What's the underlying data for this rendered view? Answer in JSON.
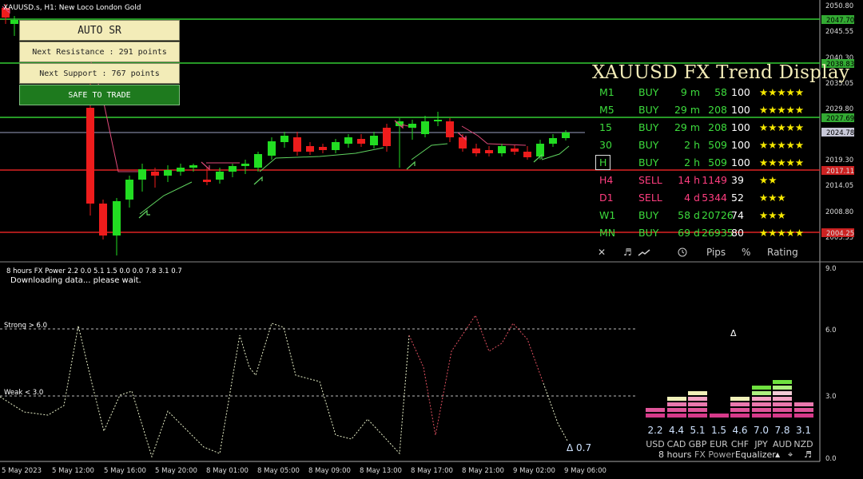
{
  "chart_header": "XAUUSD.s, H1:  New Loco London Gold",
  "price_axis": [
    "2050.80",
    "2045.55",
    "2040.30",
    "2035.05",
    "2029.80",
    "2024.78",
    "2019.30",
    "2014.05",
    "2008.80",
    "2003.55"
  ],
  "tags": {
    "r1": "2047.70",
    "r2": "2038.83",
    "r3": "2027.69",
    "cur": "2024.78",
    "s1": "2017.11",
    "s2": "2004.25"
  },
  "auto_sr": {
    "title": "AUTO  SR",
    "resistance": "Next Resistance : 291 points",
    "support": "Next Support : 767 points",
    "status": "SAFE TO TRADE"
  },
  "trend": {
    "title": "XAUUSD FX Trend Display",
    "rows": [
      {
        "tf": "M1",
        "signal": "BUY",
        "time": "9 m",
        "pips": "58",
        "pct": "100",
        "stars": "★★★★★"
      },
      {
        "tf": "M5",
        "signal": "BUY",
        "time": "29 m",
        "pips": "208",
        "pct": "100",
        "stars": "★★★★★"
      },
      {
        "tf": "15",
        "signal": "BUY",
        "time": "29 m",
        "pips": "208",
        "pct": "100",
        "stars": "★★★★★"
      },
      {
        "tf": "30",
        "signal": "BUY",
        "time": "2 h",
        "pips": "509",
        "pct": "100",
        "stars": "★★★★★"
      },
      {
        "tf": "H",
        "signal": "BUY",
        "time": "2 h",
        "pips": "509",
        "pct": "100",
        "stars": "★★★★★"
      },
      {
        "tf": "H4",
        "signal": "SELL",
        "time": "14 h",
        "pips": "1149",
        "pct": "39",
        "stars": "★★"
      },
      {
        "tf": "D1",
        "signal": "SELL",
        "time": "4 d",
        "pips": "5344",
        "pct": "52",
        "stars": "★★★"
      },
      {
        "tf": "W1",
        "signal": "BUY",
        "time": "58 d",
        "pips": "20726",
        "pct": "74",
        "stars": "★★★"
      },
      {
        "tf": "MN",
        "signal": "BUY",
        "time": "69 d",
        "pips": "26935",
        "pct": "80",
        "stars": "★★★★★"
      }
    ],
    "footer": {
      "close": "✕",
      "sound": "♬",
      "pips": "Pips",
      "percent": "%",
      "rating": "Rating"
    }
  },
  "indicator": {
    "header": "8 hours FX Power 2.2 0.0 5.1 1.5 0.0 0.0 7.8 3.1 0.7",
    "status": "Downloading data... please wait.",
    "strong_label": "Strong > 6.0",
    "weak_label": "Weak < 3.0",
    "delta_top": "Δ",
    "delta_value": "Δ 0.7",
    "axis": [
      "9.0",
      "6.0",
      "3.0",
      "0.0"
    ]
  },
  "equalizer": {
    "currencies": [
      {
        "name": "USD",
        "value": "2.2"
      },
      {
        "name": "CAD",
        "value": "4.4"
      },
      {
        "name": "GBP",
        "value": "5.1"
      },
      {
        "name": "EUR",
        "value": "1.5"
      },
      {
        "name": "CHF",
        "value": "4.6"
      },
      {
        "name": "JPY",
        "value": "7.0"
      },
      {
        "name": "AUD",
        "value": "7.8"
      },
      {
        "name": "NZD",
        "value": "3.1"
      }
    ],
    "footer": {
      "period": "8 hours",
      "product": "FX Power",
      "mode": "Equalizer"
    }
  },
  "time_axis": [
    "5 May 2023",
    "5 May 12:00",
    "5 May 16:00",
    "5 May 20:00",
    "8 May 01:00",
    "8 May 05:00",
    "8 May 09:00",
    "8 May 13:00",
    "8 May 17:00",
    "8 May 21:00",
    "9 May 02:00",
    "9 May 06:00"
  ]
}
